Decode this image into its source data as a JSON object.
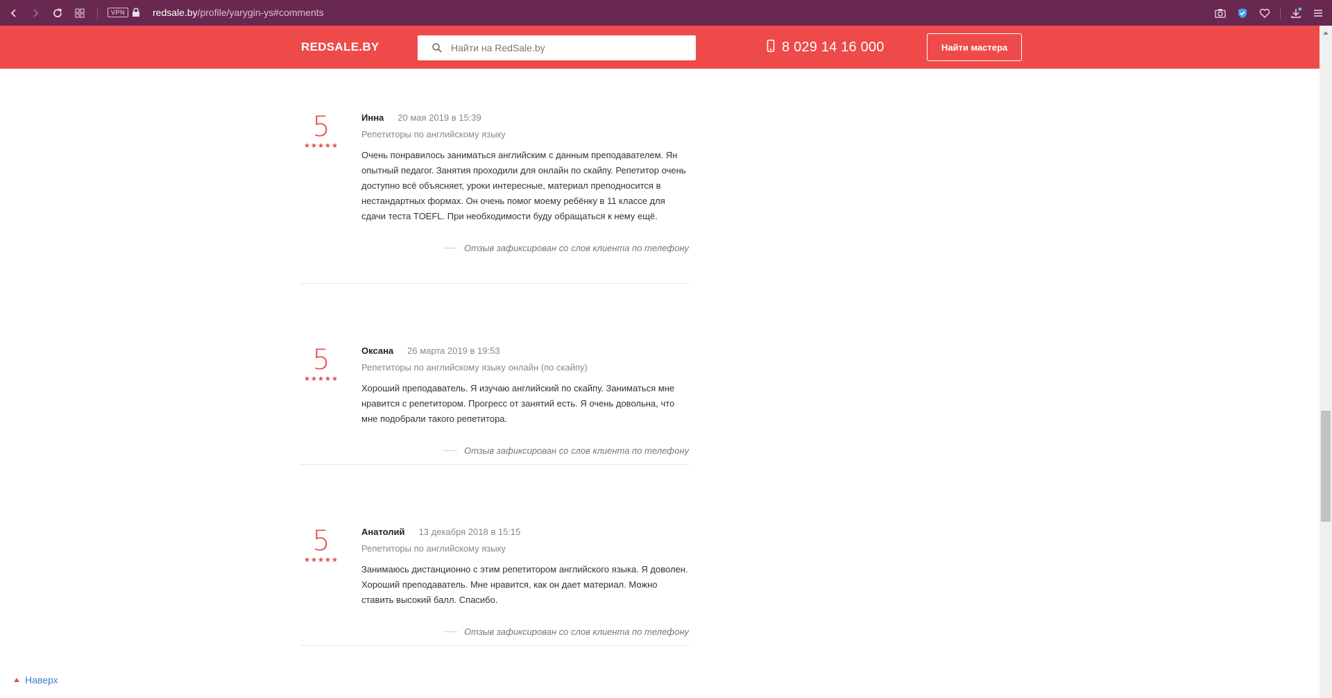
{
  "browser": {
    "vpn_label": "VPN",
    "url_host": "redsale.by",
    "url_path": "/profile/yarygin-ys#comments"
  },
  "header": {
    "logo": "REDSALE.BY",
    "search_placeholder": "Найти на RedSale.by",
    "phone": "8 029 14 16 000",
    "find_button": "Найти мастера"
  },
  "reviews": [
    {
      "score": "5",
      "rating": 5,
      "name": "Инна",
      "date": "20 мая 2019 в 15:39",
      "category": "Репетиторы по английскому языку",
      "text": "Очень понравилось заниматься английским с данным преподавателем. Ян опытный педагог. Занятия проходили для онлайн по скайпу. Репетитор очень доступно всё объясняет, уроки интересные, материал преподносится в нестандартных формах. Он очень помог моему ребёнку в 11 классе для сдачи теста TOEFL. При необходимости буду обращаться к нему ещё.",
      "note": "Отзыв зафиксирован со слов клиента по телефону"
    },
    {
      "score": "5",
      "rating": 5,
      "name": "Оксана",
      "date": "26 марта 2019 в 19:53",
      "category": "Репетиторы по английскому языку онлайн (по скайпу)",
      "text": "Хороший преподаватель. Я изучаю английский по скайпу. Заниматься мне нравится с репетитором. Прогресс от занятий есть. Я очень довольна, что мне подобрали такого репетитора.",
      "note": "Отзыв зафиксирован со слов клиента по телефону"
    },
    {
      "score": "5",
      "rating": 5,
      "name": "Анатолий",
      "date": "13 декабря 2018 в 15:15",
      "category": "Репетиторы по английскому языку",
      "text": "Занимаюсь дистанционно с этим репетитором английского языка. Я доволен. Хороший преподаватель. Мне нравится, как он дает материал. Можно ставить высокий балл. Спасибо.",
      "note": "Отзыв зафиксирован со слов клиента по телефону"
    }
  ],
  "back_to_top": "Наверх",
  "colors": {
    "browser_bar": "#68284f",
    "brand_red": "#ee4a4a",
    "link_blue": "#3a7fd0"
  }
}
